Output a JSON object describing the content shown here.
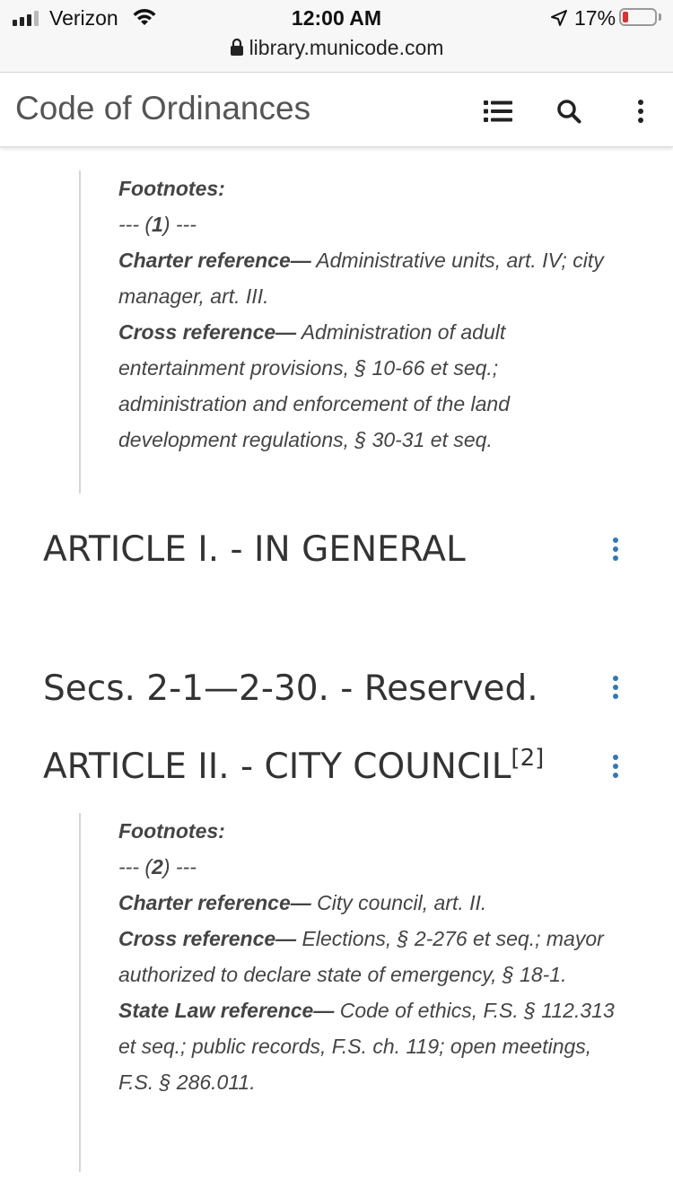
{
  "status_bar": {
    "carrier": "Verizon",
    "time": "12:00 AM",
    "battery_percent": "17%",
    "battery_level": 0.17,
    "battery_color": "#e0302a"
  },
  "url": "library.municode.com",
  "header": {
    "title": "Code of Ordinances",
    "icons": [
      "list-icon",
      "search-icon",
      "more-vertical-icon"
    ]
  },
  "footnotes_1": {
    "heading": "Footnotes:",
    "number_prefix": "--- (",
    "number": "1",
    "number_suffix": ") ---",
    "refs": [
      {
        "label": "Charter reference—",
        "text": " Administrative units, art. IV; city manager, art. III."
      },
      {
        "label": "Cross reference—",
        "text": " Administration of adult entertainment provisions, § 10-66 et seq.; administration and enforcement of the land development regulations, § 30-31 et seq."
      }
    ]
  },
  "sections": [
    {
      "title": "ARTICLE I. - IN GENERAL"
    },
    {
      "title": "Secs. 2-1—2-30. - Reserved."
    },
    {
      "title": "ARTICLE II. - CITY COUNCIL",
      "footnote_marker": "[2]"
    }
  ],
  "footnotes_2": {
    "heading": "Footnotes:",
    "number_prefix": "--- (",
    "number": "2",
    "number_suffix": ") ---",
    "refs": [
      {
        "label": "Charter reference—",
        "text": " City council, art. II."
      },
      {
        "label": "Cross reference—",
        "text": " Elections, § 2-276 et seq.; mayor authorized to declare state of emergency, § 18-1."
      },
      {
        "label": "State Law reference—",
        "text": " Code of ethics, F.S. § 112.313 et seq.; public records, F.S. ch. 119; open meetings, F.S. § 286.011."
      }
    ]
  },
  "colors": {
    "accent": "#2f79b9",
    "text": "#333333",
    "header_title": "#555555"
  }
}
